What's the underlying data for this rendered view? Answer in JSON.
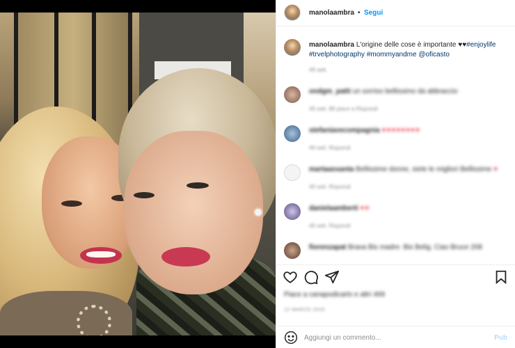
{
  "post": {
    "username": "manolaambra",
    "follow_label": "Segui",
    "separator": "•",
    "more_icon": "more-horizontal-icon"
  },
  "caption": {
    "username": "manolaambra",
    "text": "L'origine delle cose è importante",
    "hearts": "♥♥",
    "tags": [
      "#enjoylife",
      "#trvelphotography",
      "#mommyandme",
      "@oficasto"
    ],
    "time": "49 sett."
  },
  "comments": [
    {
      "user": "ondgm_patti",
      "text": "un sorriso bellissimo da abbraccio",
      "meta": "49 sett.   88 piace a   Rispondi",
      "hearts": ""
    },
    {
      "user": "stefaniavecompagnia",
      "text": "",
      "meta": "49 sett.   Rispondi",
      "hearts": "♥♥♥♥♥♥♥♥"
    },
    {
      "user": "martaassanta",
      "text": "Bellissime donne, siete le migliori Bellissime",
      "meta": "49 sett.   Rispondi",
      "hearts": "♥"
    },
    {
      "user": "danielaamberti",
      "text": "",
      "meta": "49 sett.   Rispondi",
      "hearts": "♥♥"
    },
    {
      "user": "fiorenzapat",
      "text": "Brava Bis madre. Bis Belig. Ciao Bruce 208",
      "meta": "",
      "hearts": ""
    }
  ],
  "likes_text": "Piace a canapodicarlo e altri 469",
  "post_date": "12 MARZO 2020",
  "add_comment": {
    "placeholder": "Aggiungi un commento...",
    "publish_label": "Pub"
  },
  "colors": {
    "accent": "#0095f6",
    "hashtag": "#00376b",
    "heart": "#ed4956",
    "publish_disabled": "#b2dffc"
  }
}
